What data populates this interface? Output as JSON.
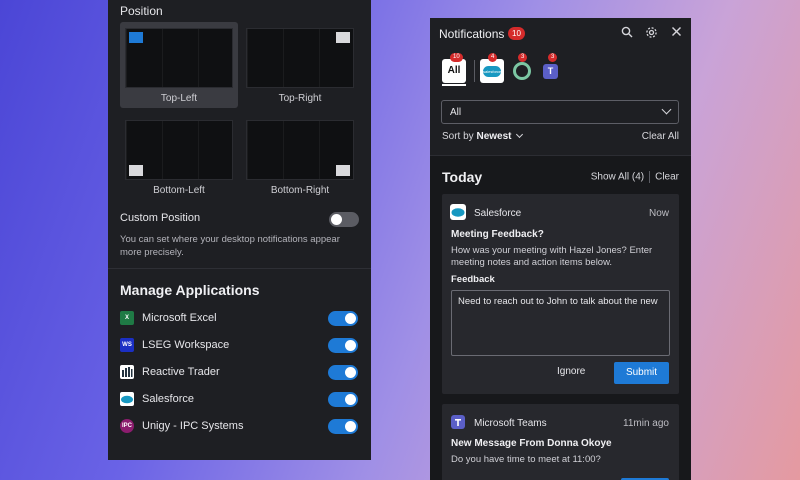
{
  "settings": {
    "position_title": "Position",
    "positions": [
      {
        "label": "Top-Left",
        "selected": true
      },
      {
        "label": "Top-Right",
        "selected": false
      },
      {
        "label": "Bottom-Left",
        "selected": false
      },
      {
        "label": "Bottom-Right",
        "selected": false
      }
    ],
    "custom_position_label": "Custom Position",
    "custom_position_enabled": false,
    "custom_position_desc": "You can set where your desktop notifications appear more precisely.",
    "manage_title": "Manage Applications",
    "apps": [
      {
        "name": "Microsoft Excel",
        "icon": "excel-icon",
        "icon_text": "X",
        "color": "#1f7a45",
        "enabled": true
      },
      {
        "name": "LSEG Workspace",
        "icon": "lseg-icon",
        "icon_text": "WS",
        "color": "#1b2fc4",
        "enabled": true
      },
      {
        "name": "Reactive Trader",
        "icon": "reactive-trader-icon",
        "icon_text": "",
        "color": "#ffffff",
        "enabled": true
      },
      {
        "name": "Salesforce",
        "icon": "salesforce-icon",
        "icon_text": "",
        "color": "#ffffff",
        "enabled": true
      },
      {
        "name": "Unigy - IPC Systems",
        "icon": "unigy-icon",
        "icon_text": "IPC",
        "color": "#8c1c6e",
        "enabled": true
      }
    ]
  },
  "notifications": {
    "title": "Notifications",
    "count": "10",
    "filter_tabs": [
      {
        "label": "All",
        "count": "10"
      },
      {
        "icon": "salesforce-icon",
        "label": "salesforce",
        "count": "4"
      },
      {
        "icon": "ring-app-icon",
        "count": "3"
      },
      {
        "icon": "teams-icon",
        "label": "T",
        "count": "3"
      }
    ],
    "select_value": "All",
    "sort_prefix": "Sort by ",
    "sort_value": "Newest",
    "clear_all": "Clear All",
    "group_title": "Today",
    "show_all": "Show All (4)",
    "clear": "Clear",
    "cards": [
      {
        "app": "Salesforce",
        "time": "Now",
        "title": "Meeting Feedback?",
        "body": "How was your meeting with Hazel Jones? Enter meeting notes and action items below.",
        "feedback_label": "Feedback",
        "feedback_value": "Need to reach out to John to talk about the new",
        "ignore_label": "Ignore",
        "submit_label": "Submit"
      },
      {
        "app": "Microsoft Teams",
        "time": "11min ago",
        "title": "New Message From Donna Okoye",
        "body": "Do you have time to meet at 11:00?"
      }
    ]
  }
}
